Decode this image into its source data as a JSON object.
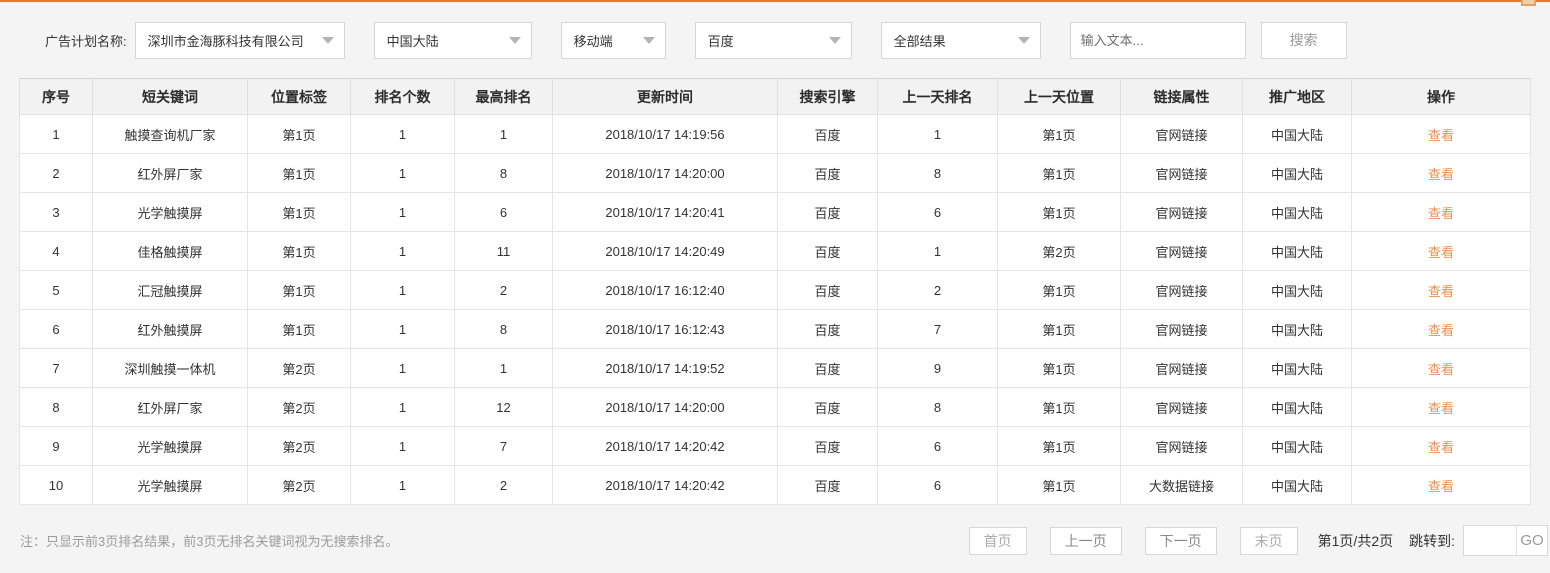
{
  "page": {
    "accent_color": "#e8792c",
    "link_color": "#ed8f4d"
  },
  "filters": {
    "label": "广告计划名称:",
    "selects": [
      {
        "name": "campaign",
        "value": "深圳市金海豚科技有限公司"
      },
      {
        "name": "region",
        "value": "中国大陆"
      },
      {
        "name": "device",
        "value": "移动端"
      },
      {
        "name": "engine",
        "value": "百度"
      },
      {
        "name": "result-type",
        "value": "全部结果"
      }
    ],
    "search_placeholder": "输入文本...",
    "search_button": "搜索"
  },
  "table": {
    "headers": [
      "序号",
      "短关键词",
      "位置标签",
      "排名个数",
      "最高排名",
      "更新时间",
      "搜索引擎",
      "上一天排名",
      "上一天位置",
      "链接属性",
      "推广地区",
      "操作"
    ],
    "action_label": "查看",
    "rows": [
      [
        "1",
        "触摸查询机厂家",
        "第1页",
        "1",
        "1",
        "2018/10/17 14:19:56",
        "百度",
        "1",
        "第1页",
        "官网链接",
        "中国大陆"
      ],
      [
        "2",
        "红外屏厂家",
        "第1页",
        "1",
        "8",
        "2018/10/17 14:20:00",
        "百度",
        "8",
        "第1页",
        "官网链接",
        "中国大陆"
      ],
      [
        "3",
        "光学触摸屏",
        "第1页",
        "1",
        "6",
        "2018/10/17 14:20:41",
        "百度",
        "6",
        "第1页",
        "官网链接",
        "中国大陆"
      ],
      [
        "4",
        "佳格触摸屏",
        "第1页",
        "1",
        "11",
        "2018/10/17 14:20:49",
        "百度",
        "1",
        "第2页",
        "官网链接",
        "中国大陆"
      ],
      [
        "5",
        "汇冠触摸屏",
        "第1页",
        "1",
        "2",
        "2018/10/17 16:12:40",
        "百度",
        "2",
        "第1页",
        "官网链接",
        "中国大陆"
      ],
      [
        "6",
        "红外触摸屏",
        "第1页",
        "1",
        "8",
        "2018/10/17 16:12:43",
        "百度",
        "7",
        "第1页",
        "官网链接",
        "中国大陆"
      ],
      [
        "7",
        "深圳触摸一体机",
        "第2页",
        "1",
        "1",
        "2018/10/17 14:19:52",
        "百度",
        "9",
        "第1页",
        "官网链接",
        "中国大陆"
      ],
      [
        "8",
        "红外屏厂家",
        "第2页",
        "1",
        "12",
        "2018/10/17 14:20:00",
        "百度",
        "8",
        "第1页",
        "官网链接",
        "中国大陆"
      ],
      [
        "9",
        "光学触摸屏",
        "第2页",
        "1",
        "7",
        "2018/10/17 14:20:42",
        "百度",
        "6",
        "第1页",
        "官网链接",
        "中国大陆"
      ],
      [
        "10",
        "光学触摸屏",
        "第2页",
        "1",
        "2",
        "2018/10/17 14:20:42",
        "百度",
        "6",
        "第1页",
        "大数据链接",
        "中国大陆"
      ]
    ]
  },
  "footer": {
    "note": "注：只显示前3页排名结果，前3页无排名关键词视为无搜索排名。",
    "pagination": {
      "first": "首页",
      "prev": "上一页",
      "next": "下一页",
      "last": "末页",
      "page_info": "第1页/共2页",
      "jump_label": "跳转到:",
      "jump_value": "",
      "go": "GO"
    }
  }
}
